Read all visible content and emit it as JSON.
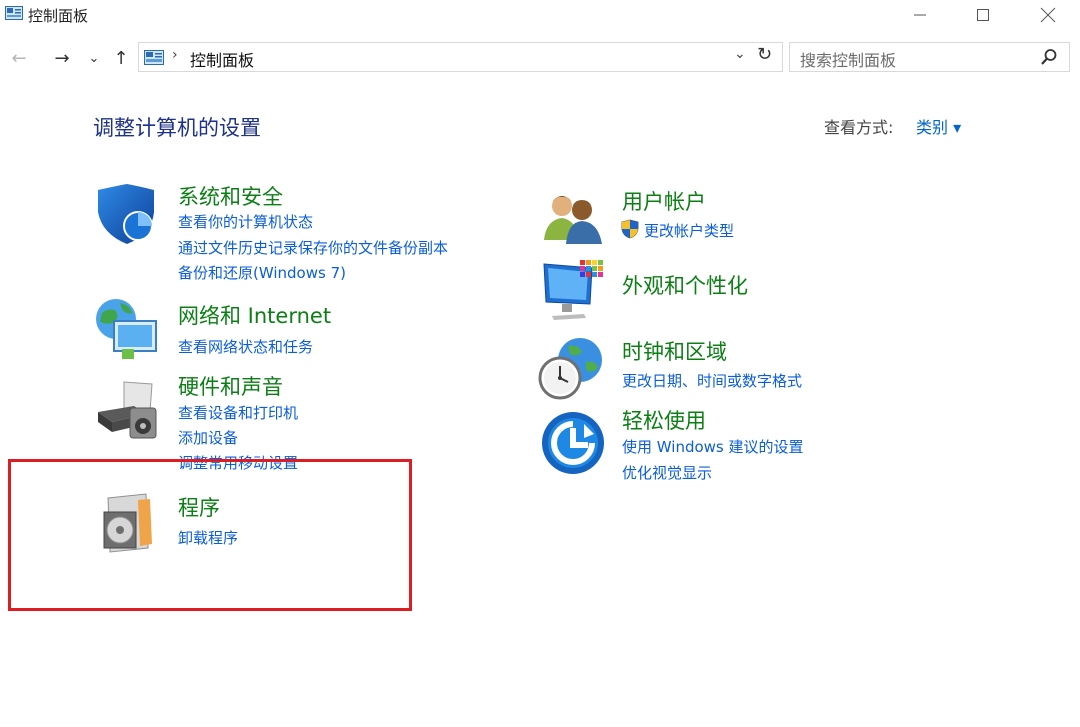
{
  "window": {
    "title": "控制面板",
    "buttons": {
      "minimize": "—",
      "maximize": "☐",
      "close": "✕"
    }
  },
  "nav": {
    "back": "←",
    "forward": "→",
    "recent": "⌄",
    "up": "↑"
  },
  "address": {
    "separator": "›",
    "path": "控制面板",
    "dropdown": "⌄",
    "refresh": "↻"
  },
  "search": {
    "placeholder": "搜索控制面板"
  },
  "header": {
    "title": "调整计算机的设置",
    "view_label": "查看方式:",
    "view_value": "类别 ▾"
  },
  "categories": {
    "system": {
      "title": "系统和安全",
      "links": [
        "查看你的计算机状态",
        "通过文件历史记录保存你的文件备份副本",
        "备份和还原(Windows 7)"
      ]
    },
    "network": {
      "title": "网络和 Internet",
      "links": [
        "查看网络状态和任务"
      ]
    },
    "hardware": {
      "title": "硬件和声音",
      "links": [
        "查看设备和打印机",
        "添加设备",
        "调整常用移动设置"
      ]
    },
    "programs": {
      "title": "程序",
      "links": [
        "卸载程序"
      ]
    },
    "users": {
      "title": "用户帐户",
      "links": [
        "更改帐户类型"
      ]
    },
    "appearance": {
      "title": "外观和个性化",
      "links": []
    },
    "clock": {
      "title": "时钟和区域",
      "links": [
        "更改日期、时间或数字格式"
      ]
    },
    "ease": {
      "title": "轻松使用",
      "links": [
        "使用 Windows 建议的设置",
        "优化视觉显示"
      ]
    }
  },
  "colors": {
    "category_title": "#0c7f14",
    "link": "#0b5ed7",
    "heading": "#1e3287",
    "highlight_box": "#dc1e24"
  }
}
